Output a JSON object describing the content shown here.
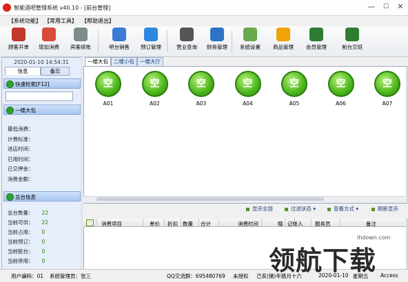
{
  "window": {
    "title": "智能酒吧管理系统 v40.10 - [前台管理]",
    "controls": {
      "minimize": "—",
      "maximize": "☐",
      "close": "✕"
    }
  },
  "menu": [
    "【系统功能】",
    "【常用工具】",
    "【帮助退出】"
  ],
  "toolbar": [
    {
      "label": "顾客开单",
      "icon": "customer-icon",
      "color": "#c0392b"
    },
    {
      "label": "增加消费",
      "icon": "cubes-icon",
      "color": "#d94a3a"
    },
    {
      "label": "宾客续账",
      "icon": "calculator-icon",
      "color": "#7f8c8d"
    },
    {
      "label": "吧台销售",
      "icon": "monitor-icon",
      "color": "#3a7bd5"
    },
    {
      "label": "预订管理",
      "icon": "clock-icon",
      "color": "#2e86de"
    },
    {
      "label": "营业查询",
      "icon": "search-icon",
      "color": "#555555"
    },
    {
      "label": "财务管理",
      "icon": "ledger-icon",
      "color": "#2d74c4"
    },
    {
      "label": "系统设置",
      "icon": "gear-icon",
      "color": "#6aa84f"
    },
    {
      "label": "商品管理",
      "icon": "star-icon",
      "color": "#f1a208"
    },
    {
      "label": "会员管理",
      "icon": "members-icon",
      "color": "#2e7d32"
    },
    {
      "label": "前台交班",
      "icon": "handover-icon",
      "color": "#2e7d32"
    }
  ],
  "left": {
    "datetime": "2020-01-10 14:54:31",
    "tabs": [
      "信息",
      "备忘"
    ],
    "quick_search": "快速检索[F12]",
    "area_header": "一楼大包",
    "fields": [
      "最低消费：",
      "计费标准：",
      "进店时间：",
      "已用时间：",
      "已交押金：",
      "消费金额："
    ],
    "summary_header": "总台信息",
    "stats": [
      {
        "label": "总台数量：",
        "value": "22"
      },
      {
        "label": "当前可供：",
        "value": "22"
      },
      {
        "label": "当前占用：",
        "value": "0"
      },
      {
        "label": "当前预订：",
        "value": "0"
      },
      {
        "label": "当前脏台：",
        "value": "0"
      },
      {
        "label": "当前停用：",
        "value": "0"
      }
    ]
  },
  "areas": [
    "一楼大包",
    "二楼小包",
    "一楼大厅"
  ],
  "tables": [
    {
      "name": "A01",
      "status": "空"
    },
    {
      "name": "A02",
      "status": "空"
    },
    {
      "name": "A03",
      "status": "空"
    },
    {
      "name": "A04",
      "status": "空"
    },
    {
      "name": "A05",
      "status": "空"
    },
    {
      "name": "A06",
      "status": "空"
    },
    {
      "name": "A07",
      "status": "空"
    }
  ],
  "actions": [
    "显示全部",
    "过滤状态 ▾",
    "查看方式 ▾",
    "刷新显示"
  ],
  "grid_columns": [
    "消费项目",
    "单价",
    "折扣",
    "数量",
    "合计",
    "消费时间",
    "赠",
    "记帐人",
    "服务员",
    "备注"
  ],
  "status": {
    "user_code": "用户编码：01",
    "operator": "系统管理员：张三",
    "qq": "QQ交流群：695480769",
    "license": "未授权",
    "date": "己亥(猪)年腊月十六",
    "datetime": "2020-01-10",
    "weekday": "星期五",
    "db": "Access"
  },
  "watermark": {
    "text": "领航下载",
    "url": "lhdown.com"
  }
}
